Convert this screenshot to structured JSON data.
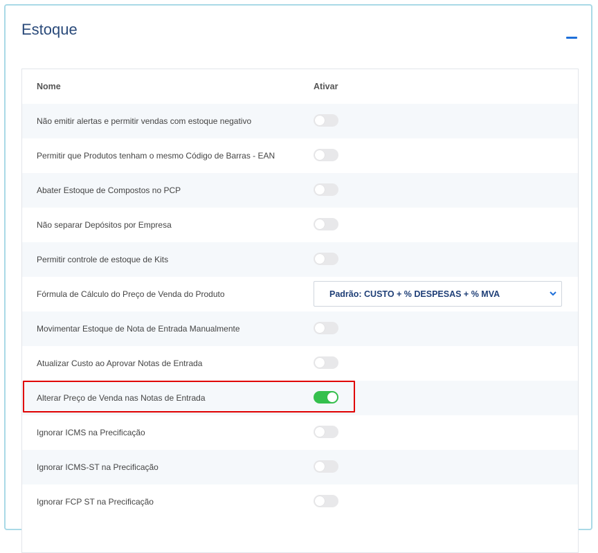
{
  "panel": {
    "title": "Estoque"
  },
  "table": {
    "headers": {
      "name": "Nome",
      "active": "Ativar"
    },
    "rows": [
      {
        "label": "Não emitir alertas e permitir vendas com estoque negativo",
        "on": false
      },
      {
        "label": "Permitir que Produtos tenham o mesmo Código de Barras - EAN",
        "on": false
      },
      {
        "label": "Abater Estoque de Compostos no PCP",
        "on": false
      },
      {
        "label": "Não separar Depósitos por Empresa",
        "on": false
      },
      {
        "label": "Permitir controle de estoque de Kits",
        "on": false
      },
      {
        "label": "Fórmula de Cálculo do Preço de Venda do Produto",
        "select": "Padrão: CUSTO + % DESPESAS + % MVA"
      },
      {
        "label": "Movimentar Estoque de Nota de Entrada Manualmente",
        "on": false
      },
      {
        "label": "Atualizar Custo ao Aprovar Notas de Entrada",
        "on": false
      },
      {
        "label": "Alterar Preço de Venda nas Notas de Entrada",
        "on": true
      },
      {
        "label": "Ignorar ICMS na Precificação",
        "on": false
      },
      {
        "label": "Ignorar ICMS-ST na Precificação",
        "on": false
      },
      {
        "label": "Ignorar FCP ST na Precificação",
        "on": false
      }
    ]
  },
  "colors": {
    "toggle_on": "#35c04d",
    "toggle_off": "#e8e8ea",
    "highlight": "#e00000",
    "title": "#2a4a7a"
  },
  "icons": {
    "collapse": "minus-icon",
    "select": "chevron-down-icon"
  }
}
